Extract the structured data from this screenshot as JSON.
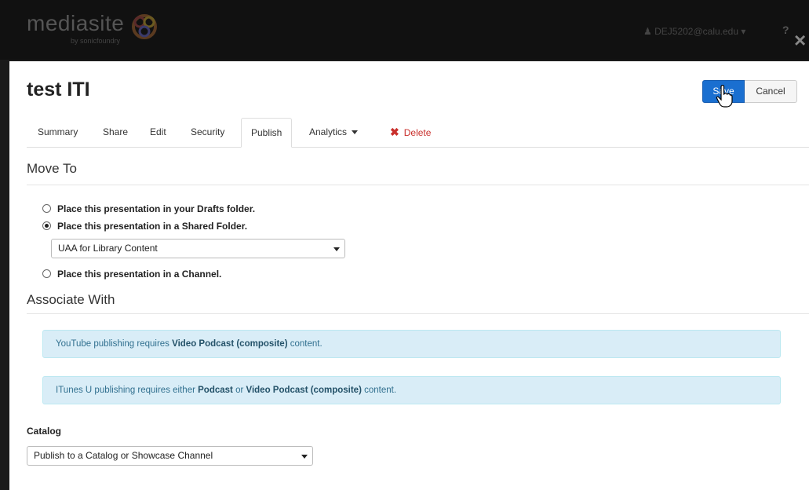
{
  "app": {
    "logo_text": "mediasite",
    "logo_sub": "by sonicfoundry",
    "user": "DEJ5202@calu.edu",
    "help_symbol": "?",
    "close_symbol": "×"
  },
  "page": {
    "title": "test ITI",
    "save_label": "Save",
    "cancel_label": "Cancel"
  },
  "tabs": [
    {
      "label": "Summary"
    },
    {
      "label": "Share"
    },
    {
      "label": "Edit"
    },
    {
      "label": "Security"
    },
    {
      "label": "Publish",
      "active": true
    },
    {
      "label": "Analytics"
    },
    {
      "label": "Delete"
    }
  ],
  "move_to": {
    "heading": "Move To",
    "options": [
      {
        "label": "Place this presentation in your Drafts folder.",
        "checked": false
      },
      {
        "label": "Place this presentation in a Shared Folder.",
        "checked": true
      },
      {
        "label": "Place this presentation in a Channel.",
        "checked": false
      }
    ],
    "folder_select_value": "UAA for Library Content"
  },
  "associate_with": {
    "heading": "Associate With",
    "youtube_pre": "YouTube publishing requires ",
    "youtube_bold": "Video Podcast (composite)",
    "youtube_post": " content.",
    "itunes_pre": "ITunes U publishing requires either ",
    "itunes_bold1": "Podcast",
    "itunes_mid": " or ",
    "itunes_bold2": "Video Podcast (composite)",
    "itunes_post": " content."
  },
  "catalog": {
    "label": "Catalog",
    "select_value": "Publish to a Catalog or Showcase Channel"
  },
  "colors": {
    "primary": "#1a6fd0",
    "danger": "#c9302c",
    "info_bg": "#d9edf7"
  }
}
